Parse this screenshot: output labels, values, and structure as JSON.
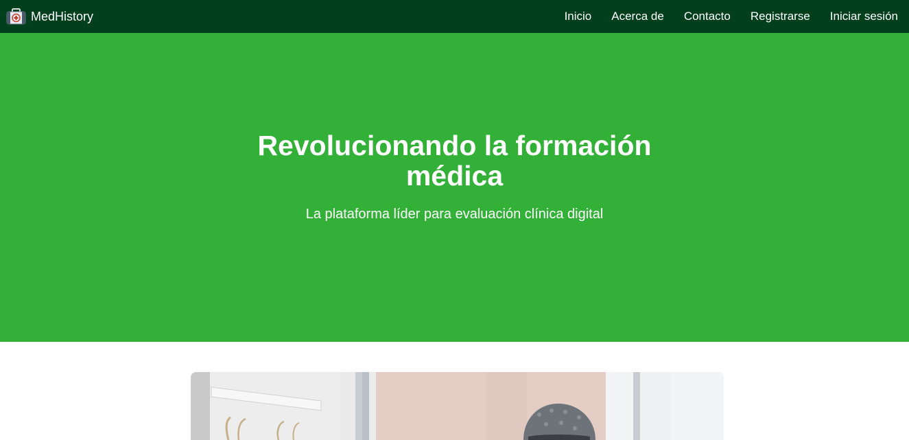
{
  "navbar": {
    "brand_name": "MedHistory",
    "brand_icon": "medical-kit-icon",
    "links": [
      {
        "label": "Inicio"
      },
      {
        "label": "Acerca de"
      },
      {
        "label": "Contacto"
      },
      {
        "label": "Registrarse"
      },
      {
        "label": "Iniciar sesión"
      }
    ]
  },
  "hero": {
    "title": "Revolucionando la formación médica",
    "subtitle": "La plataforma líder para evaluación clínica digital"
  },
  "colors": {
    "navbar_bg": "#023f1c",
    "hero_bg": "#33b038",
    "text": "#ffffff"
  }
}
